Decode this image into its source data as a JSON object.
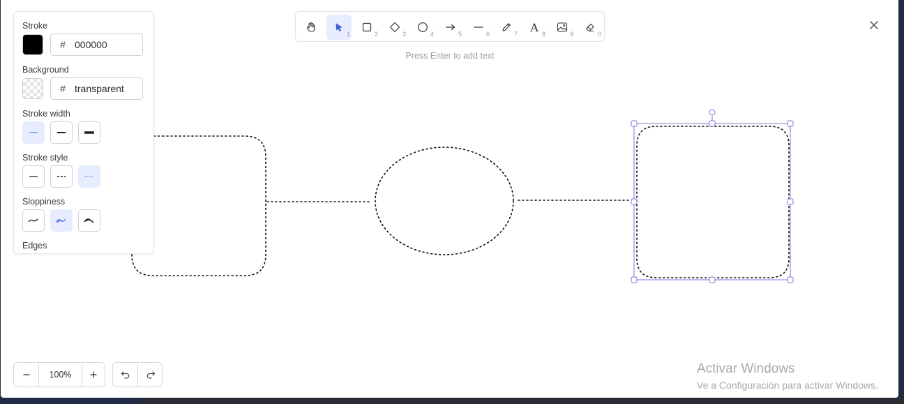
{
  "panel": {
    "stroke_label": "Stroke",
    "stroke_hash": "#",
    "stroke_value": "000000",
    "background_label": "Background",
    "background_hash": "#",
    "background_value": "transparent",
    "stroke_width_label": "Stroke width",
    "stroke_style_label": "Stroke style",
    "sloppiness_label": "Sloppiness",
    "edges_label": "Edges",
    "stroke_width_options": [
      "thin",
      "bold",
      "extra-bold"
    ],
    "stroke_width_selected": "thin",
    "stroke_style_options": [
      "solid",
      "dashed",
      "dotted"
    ],
    "stroke_style_selected": "dotted",
    "sloppiness_options": [
      "architect",
      "artist",
      "cartoonist"
    ],
    "sloppiness_selected": "artist",
    "accent_color": "#4a6ee0",
    "active_bg": "#e7edfe"
  },
  "toolbar": {
    "tools": [
      {
        "icon": "hand-icon",
        "num": ""
      },
      {
        "icon": "pointer-icon",
        "num": "1"
      },
      {
        "icon": "rectangle-icon",
        "num": "2"
      },
      {
        "icon": "diamond-icon",
        "num": "3"
      },
      {
        "icon": "ellipse-icon",
        "num": "4"
      },
      {
        "icon": "arrow-icon",
        "num": "5"
      },
      {
        "icon": "line-icon",
        "num": "6"
      },
      {
        "icon": "pencil-icon",
        "num": "7"
      },
      {
        "icon": "text-icon",
        "num": "8"
      },
      {
        "icon": "image-icon",
        "num": "9"
      },
      {
        "icon": "eraser-icon",
        "num": "0"
      }
    ],
    "active_tool": "pointer-icon",
    "text_tool_glyph": "A",
    "hint": "Press Enter to add text"
  },
  "zoom": {
    "level": "100%"
  },
  "watermark": {
    "title": "Activar Windows",
    "subtitle": "Ve a Configuración para activar Windows."
  },
  "selection_color": "#7b74d8"
}
